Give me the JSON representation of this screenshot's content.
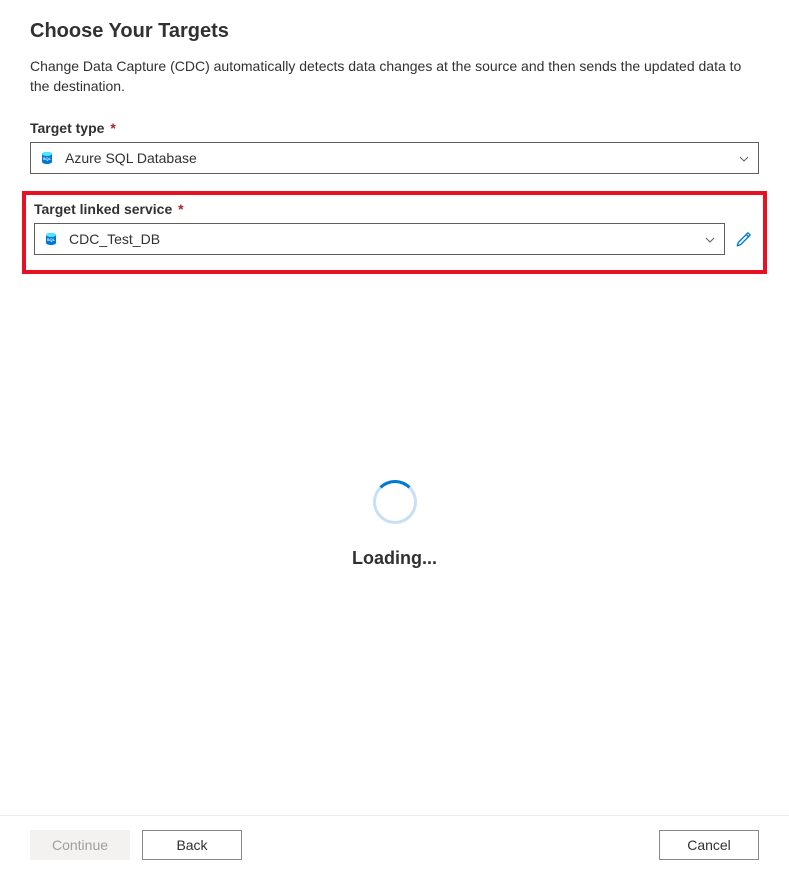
{
  "page": {
    "title": "Choose Your Targets",
    "description": "Change Data Capture (CDC) automatically detects data changes at the source and then sends the updated data to the destination."
  },
  "targetType": {
    "label": "Target type",
    "required": "*",
    "value": "Azure SQL Database",
    "icon": "azure-sql-icon"
  },
  "linkedService": {
    "label": "Target linked service",
    "required": "*",
    "value": "CDC_Test_DB",
    "icon": "azure-sql-icon"
  },
  "loading": {
    "text": "Loading..."
  },
  "footer": {
    "continue": "Continue",
    "back": "Back",
    "cancel": "Cancel"
  }
}
